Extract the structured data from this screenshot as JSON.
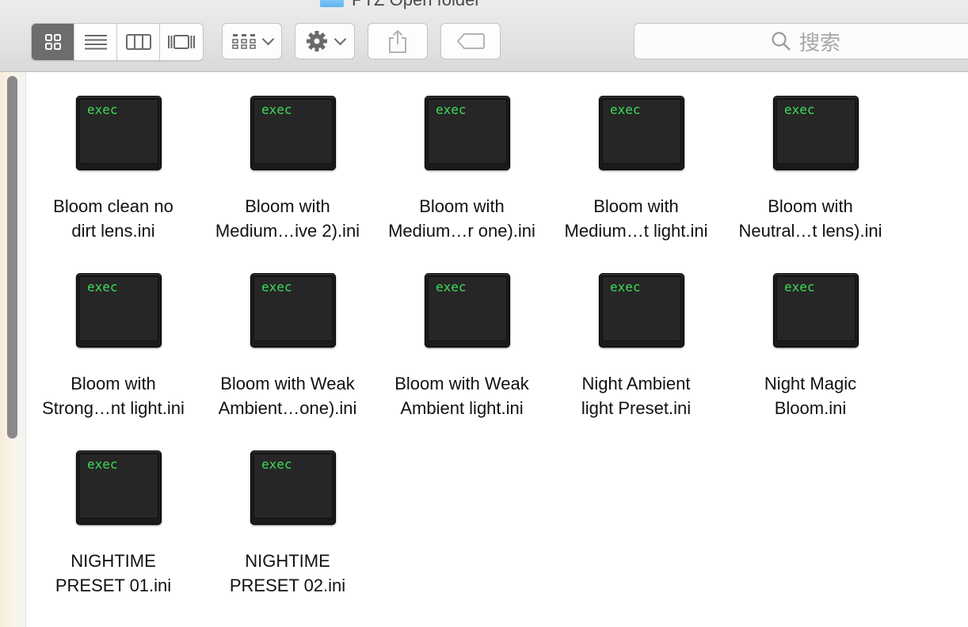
{
  "window": {
    "title": "PTZ Open folder"
  },
  "toolbar": {
    "views": [
      "icon-view",
      "list-view",
      "column-view",
      "gallery-view"
    ],
    "active_view": "icon-view",
    "search_placeholder": "搜索"
  },
  "files": [
    {
      "name": "Bloom clean no\ndirt lens.ini",
      "icon_text": "exec"
    },
    {
      "name": "Bloom with\nMedium…ive 2).ini",
      "icon_text": "exec"
    },
    {
      "name": "Bloom with\nMedium…r one).ini",
      "icon_text": "exec"
    },
    {
      "name": "Bloom with\nMedium…t light.ini",
      "icon_text": "exec"
    },
    {
      "name": "Bloom with\nNeutral…t lens).ini",
      "icon_text": "exec"
    },
    {
      "name": "Bloom with\nStrong…nt light.ini",
      "icon_text": "exec"
    },
    {
      "name": "Bloom with Weak\nAmbient…one).ini",
      "icon_text": "exec"
    },
    {
      "name": "Bloom with Weak\nAmbient light.ini",
      "icon_text": "exec"
    },
    {
      "name": "Night Ambient\nlight Preset.ini",
      "icon_text": "exec"
    },
    {
      "name": "Night Magic\nBloom.ini",
      "icon_text": "exec"
    },
    {
      "name": "NIGHTIME\nPRESET 01.ini",
      "icon_text": "exec"
    },
    {
      "name": "NIGHTIME\nPRESET 02.ini",
      "icon_text": "exec"
    }
  ],
  "colors": {
    "terminal_text": "#3ddc5a",
    "active_segment": "#6d6d6d"
  }
}
